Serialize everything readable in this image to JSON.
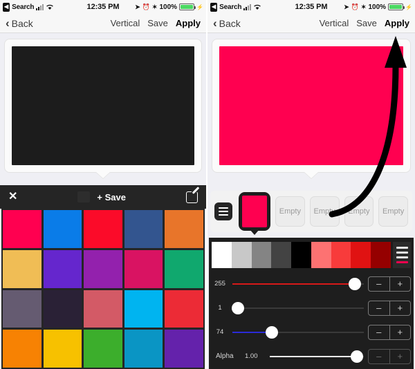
{
  "status_bar": {
    "back_chip": "◀",
    "carrier_label": "Search",
    "signal_icon": "signal-bars-icon",
    "wifi_icon": "wifi-icon",
    "time": "12:35 PM",
    "location_icon": "➤",
    "alarm_icon": "⏰",
    "bluetooth_icon": "✶",
    "battery_percent": "100%",
    "charging_icon": "⚡"
  },
  "nav_bar": {
    "back_label": "Back",
    "back_icon": "chevron-left-icon",
    "vertical_label": "Vertical",
    "save_label": "Save",
    "apply_label": "Apply"
  },
  "left_panel": {
    "preview_color": "#1c1c1c",
    "toolbar": {
      "close_icon": "✕",
      "current_chip_color": "#2d2d2d",
      "save_label": "+ Save",
      "edit_icon": "edit-pencil-icon"
    },
    "grid_colors": [
      "#ff0050",
      "#0a7ce8",
      "#fb0b29",
      "#33558f",
      "#e8752a",
      "#f0bd55",
      "#6526cd",
      "#9321ad",
      "#d91362",
      "#10a86e",
      "#655b71",
      "#2a2136",
      "#d35a66",
      "#00b4f0",
      "#ec2b36",
      "#f78203",
      "#f7c100",
      "#3cae2c",
      "#0a95c4",
      "#6422ab"
    ]
  },
  "right_panel": {
    "preview_color": "#ff0050",
    "annotation": "curved-arrow-to-apply",
    "tray": {
      "menu_icon": "hamburger-menu-icon",
      "selected_color": "#ff0050",
      "empty_slots": [
        "Empty",
        "Empty",
        "Empty",
        "Empty"
      ]
    },
    "spectrum": {
      "swatches": [
        "#ffffff",
        "#c8c8c8",
        "#848484",
        "#434343",
        "#000000",
        "#fd7272",
        "#f83b3b",
        "#e01212",
        "#950000"
      ],
      "menu_icon": "spectrum-menu-icon",
      "menu_accent_color": "#f5004f"
    },
    "sliders": [
      {
        "label": "255",
        "value": "",
        "fill_color": "#d81919",
        "percent": 93,
        "stepper_minus": "–",
        "stepper_plus": "+",
        "dim": false
      },
      {
        "label": "1",
        "value": "",
        "fill_color": "#2a2a2a",
        "percent": 4,
        "stepper_minus": "–",
        "stepper_plus": "+",
        "dim": false
      },
      {
        "label": "74",
        "value": "",
        "fill_color": "#2b2bd8",
        "percent": 30,
        "stepper_minus": "–",
        "stepper_plus": "+",
        "dim": false
      },
      {
        "label": "Alpha",
        "value": "1.00",
        "fill_color": "#f0f0f0",
        "percent": 93,
        "stepper_minus": "–",
        "stepper_plus": "+",
        "dim": true
      }
    ]
  }
}
